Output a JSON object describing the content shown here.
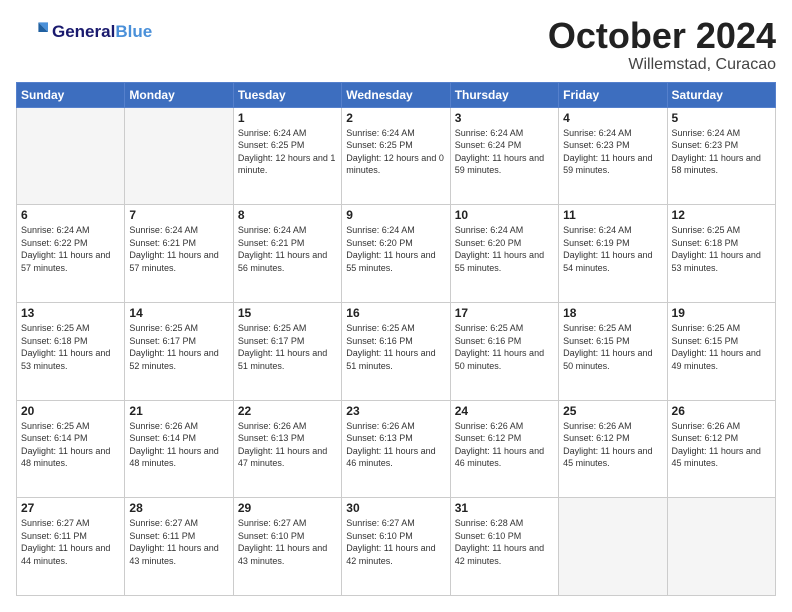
{
  "header": {
    "logo": {
      "general": "General",
      "blue": "Blue"
    },
    "month": "October 2024",
    "location": "Willemstad, Curacao"
  },
  "weekdays": [
    "Sunday",
    "Monday",
    "Tuesday",
    "Wednesday",
    "Thursday",
    "Friday",
    "Saturday"
  ],
  "weeks": [
    [
      {
        "day": "",
        "empty": true
      },
      {
        "day": "",
        "empty": true
      },
      {
        "day": "1",
        "sunrise": "6:24 AM",
        "sunset": "6:25 PM",
        "daylight": "12 hours and 1 minute."
      },
      {
        "day": "2",
        "sunrise": "6:24 AM",
        "sunset": "6:25 PM",
        "daylight": "12 hours and 0 minutes."
      },
      {
        "day": "3",
        "sunrise": "6:24 AM",
        "sunset": "6:24 PM",
        "daylight": "11 hours and 59 minutes."
      },
      {
        "day": "4",
        "sunrise": "6:24 AM",
        "sunset": "6:23 PM",
        "daylight": "11 hours and 59 minutes."
      },
      {
        "day": "5",
        "sunrise": "6:24 AM",
        "sunset": "6:23 PM",
        "daylight": "11 hours and 58 minutes."
      }
    ],
    [
      {
        "day": "6",
        "sunrise": "6:24 AM",
        "sunset": "6:22 PM",
        "daylight": "11 hours and 57 minutes."
      },
      {
        "day": "7",
        "sunrise": "6:24 AM",
        "sunset": "6:21 PM",
        "daylight": "11 hours and 57 minutes."
      },
      {
        "day": "8",
        "sunrise": "6:24 AM",
        "sunset": "6:21 PM",
        "daylight": "11 hours and 56 minutes."
      },
      {
        "day": "9",
        "sunrise": "6:24 AM",
        "sunset": "6:20 PM",
        "daylight": "11 hours and 55 minutes."
      },
      {
        "day": "10",
        "sunrise": "6:24 AM",
        "sunset": "6:20 PM",
        "daylight": "11 hours and 55 minutes."
      },
      {
        "day": "11",
        "sunrise": "6:24 AM",
        "sunset": "6:19 PM",
        "daylight": "11 hours and 54 minutes."
      },
      {
        "day": "12",
        "sunrise": "6:25 AM",
        "sunset": "6:18 PM",
        "daylight": "11 hours and 53 minutes."
      }
    ],
    [
      {
        "day": "13",
        "sunrise": "6:25 AM",
        "sunset": "6:18 PM",
        "daylight": "11 hours and 53 minutes."
      },
      {
        "day": "14",
        "sunrise": "6:25 AM",
        "sunset": "6:17 PM",
        "daylight": "11 hours and 52 minutes."
      },
      {
        "day": "15",
        "sunrise": "6:25 AM",
        "sunset": "6:17 PM",
        "daylight": "11 hours and 51 minutes."
      },
      {
        "day": "16",
        "sunrise": "6:25 AM",
        "sunset": "6:16 PM",
        "daylight": "11 hours and 51 minutes."
      },
      {
        "day": "17",
        "sunrise": "6:25 AM",
        "sunset": "6:16 PM",
        "daylight": "11 hours and 50 minutes."
      },
      {
        "day": "18",
        "sunrise": "6:25 AM",
        "sunset": "6:15 PM",
        "daylight": "11 hours and 50 minutes."
      },
      {
        "day": "19",
        "sunrise": "6:25 AM",
        "sunset": "6:15 PM",
        "daylight": "11 hours and 49 minutes."
      }
    ],
    [
      {
        "day": "20",
        "sunrise": "6:25 AM",
        "sunset": "6:14 PM",
        "daylight": "11 hours and 48 minutes."
      },
      {
        "day": "21",
        "sunrise": "6:26 AM",
        "sunset": "6:14 PM",
        "daylight": "11 hours and 48 minutes."
      },
      {
        "day": "22",
        "sunrise": "6:26 AM",
        "sunset": "6:13 PM",
        "daylight": "11 hours and 47 minutes."
      },
      {
        "day": "23",
        "sunrise": "6:26 AM",
        "sunset": "6:13 PM",
        "daylight": "11 hours and 46 minutes."
      },
      {
        "day": "24",
        "sunrise": "6:26 AM",
        "sunset": "6:12 PM",
        "daylight": "11 hours and 46 minutes."
      },
      {
        "day": "25",
        "sunrise": "6:26 AM",
        "sunset": "6:12 PM",
        "daylight": "11 hours and 45 minutes."
      },
      {
        "day": "26",
        "sunrise": "6:26 AM",
        "sunset": "6:12 PM",
        "daylight": "11 hours and 45 minutes."
      }
    ],
    [
      {
        "day": "27",
        "sunrise": "6:27 AM",
        "sunset": "6:11 PM",
        "daylight": "11 hours and 44 minutes."
      },
      {
        "day": "28",
        "sunrise": "6:27 AM",
        "sunset": "6:11 PM",
        "daylight": "11 hours and 43 minutes."
      },
      {
        "day": "29",
        "sunrise": "6:27 AM",
        "sunset": "6:10 PM",
        "daylight": "11 hours and 43 minutes."
      },
      {
        "day": "30",
        "sunrise": "6:27 AM",
        "sunset": "6:10 PM",
        "daylight": "11 hours and 42 minutes."
      },
      {
        "day": "31",
        "sunrise": "6:28 AM",
        "sunset": "6:10 PM",
        "daylight": "11 hours and 42 minutes."
      },
      {
        "day": "",
        "empty": true
      },
      {
        "day": "",
        "empty": true
      }
    ]
  ]
}
